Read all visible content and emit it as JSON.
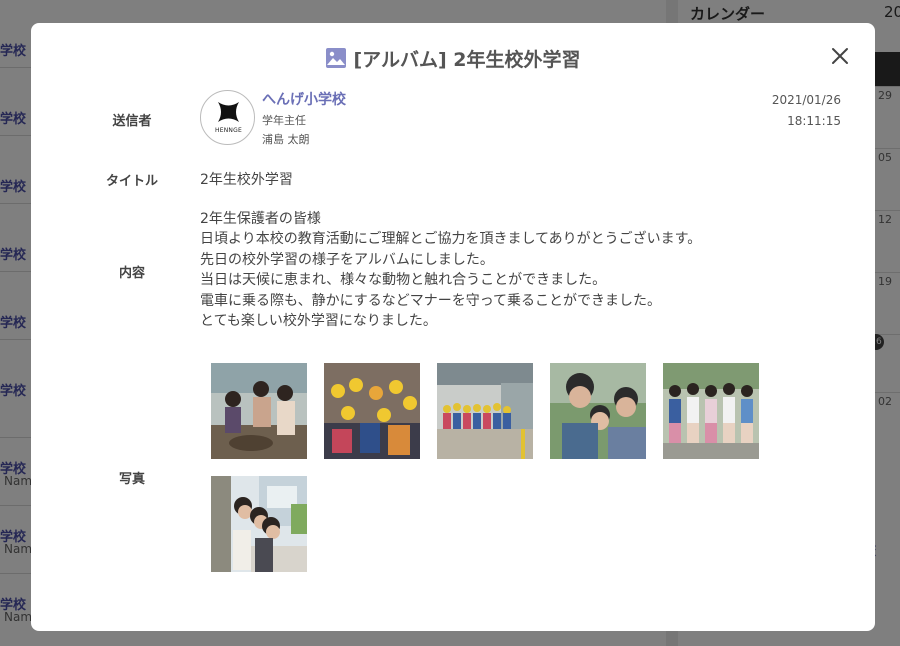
{
  "background": {
    "list_items": [
      {
        "name": "学校",
        "sub": ""
      },
      {
        "name": "学校",
        "sub": ""
      },
      {
        "name": "学校",
        "sub": ""
      },
      {
        "name": "学校",
        "sub": ""
      },
      {
        "name": "学校",
        "sub": ""
      },
      {
        "name": "学校",
        "sub": ""
      },
      {
        "name": "学校",
        "sub": "Nam"
      },
      {
        "name": "学校",
        "sub": "Nam"
      },
      {
        "name": "学校",
        "sub": "Nam"
      }
    ],
    "calendar_title": "カレンダー",
    "calendar_year": "20",
    "calendar_days": [
      "29",
      "05",
      "12",
      "19",
      "",
      "02"
    ],
    "calendar_badge": "26",
    "dash": "—",
    "school": "学校"
  },
  "modal": {
    "title": "[アルバム] 2年生校外学習",
    "title_icon": "album-image-icon",
    "close_icon": "close-icon",
    "labels": {
      "sender": "送信者",
      "title": "タイトル",
      "content": "内容",
      "photos": "写真"
    },
    "sender": {
      "avatar_text": "HENNGE",
      "name": "へんげ小学校",
      "role": "学年主任",
      "person": "浦島 太朗"
    },
    "date": "2021/01/26",
    "time": "18:11:15",
    "title_value": "2年生校外学習",
    "body_lines": [
      "2年生保護者の皆様",
      "日頃より本校の教育活動にご理解とご協力を頂きましてありがとうございます。",
      "先日の校外学習の様子をアルバムにしました。",
      "当日は天候に恵まれ、様々な動物と触れ合うことができました。",
      "電車に乗る際も、静かにするなどマナーを守って乗ることができました。",
      "とても楽しい校外学習になりました。"
    ],
    "photos": [
      {
        "scene": "children-with-animal"
      },
      {
        "scene": "children-yellow-hats-group"
      },
      {
        "scene": "children-on-train-platform"
      },
      {
        "scene": "two-boys-peace-sign"
      },
      {
        "scene": "girls-sitting-in-row"
      },
      {
        "scene": "girls-peeking-behind-wall"
      }
    ]
  }
}
